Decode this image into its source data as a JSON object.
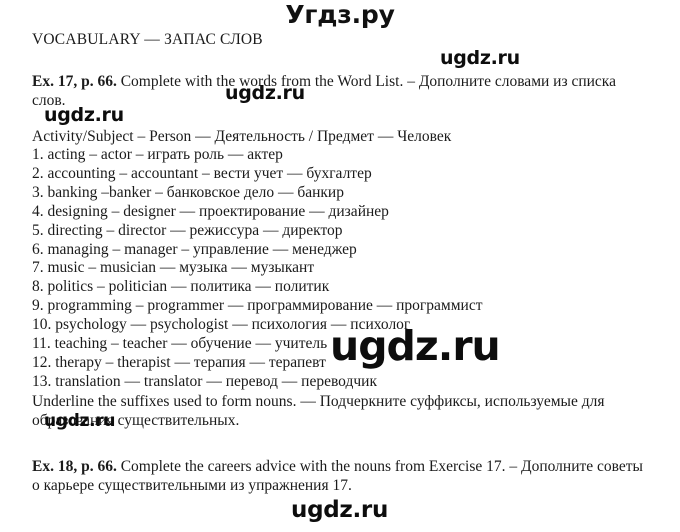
{
  "site": {
    "logo": "Угдз.ру",
    "watermark": "ugdz.ru"
  },
  "document": {
    "section_title": "VOCABULARY — ЗАПАС СЛОВ",
    "exercise_17": {
      "lead": "Ex. 17, p. 66.",
      "text": " Complete with the words from the Word List. – Дополните словами из списка слов.",
      "list_header": "Activity/Subject – Person — Деятельность / Предмет — Человек",
      "items": [
        "1. acting – actor – играть роль — актер",
        "2. accounting – accountant – вести учет — бухгалтер",
        "3. banking –banker – банковское дело — банкир",
        "4. designing – designer — проектирование — дизайнер",
        "5. directing – director — режиссура — директор",
        "6. managing – manager – управление — менеджер",
        "7. music – musician — музыка — музыкант",
        "8. politics – politician — политика — политик",
        "9. programming – programmer — программирование — программист",
        "10. psychology — psychologist — психология — психолог",
        "11. teaching – teacher — обучение — учитель",
        "12. therapy – therapist — терапия — терапевт",
        "13. translation — translator — перевод — переводчик"
      ],
      "note": "Underline the suffixes used to form nouns. — Подчеркните суффиксы, используемые для образования существительных."
    },
    "exercise_18": {
      "lead": "Ex. 18, p. 66.",
      "text": " Complete the careers advice with the nouns from Exercise 17. – Дополните советы о карьере существительными из упражнения 17."
    }
  },
  "colors": {
    "background": "#ffffff",
    "text": "#1b1b1b",
    "watermark": "#0d0d0d"
  }
}
